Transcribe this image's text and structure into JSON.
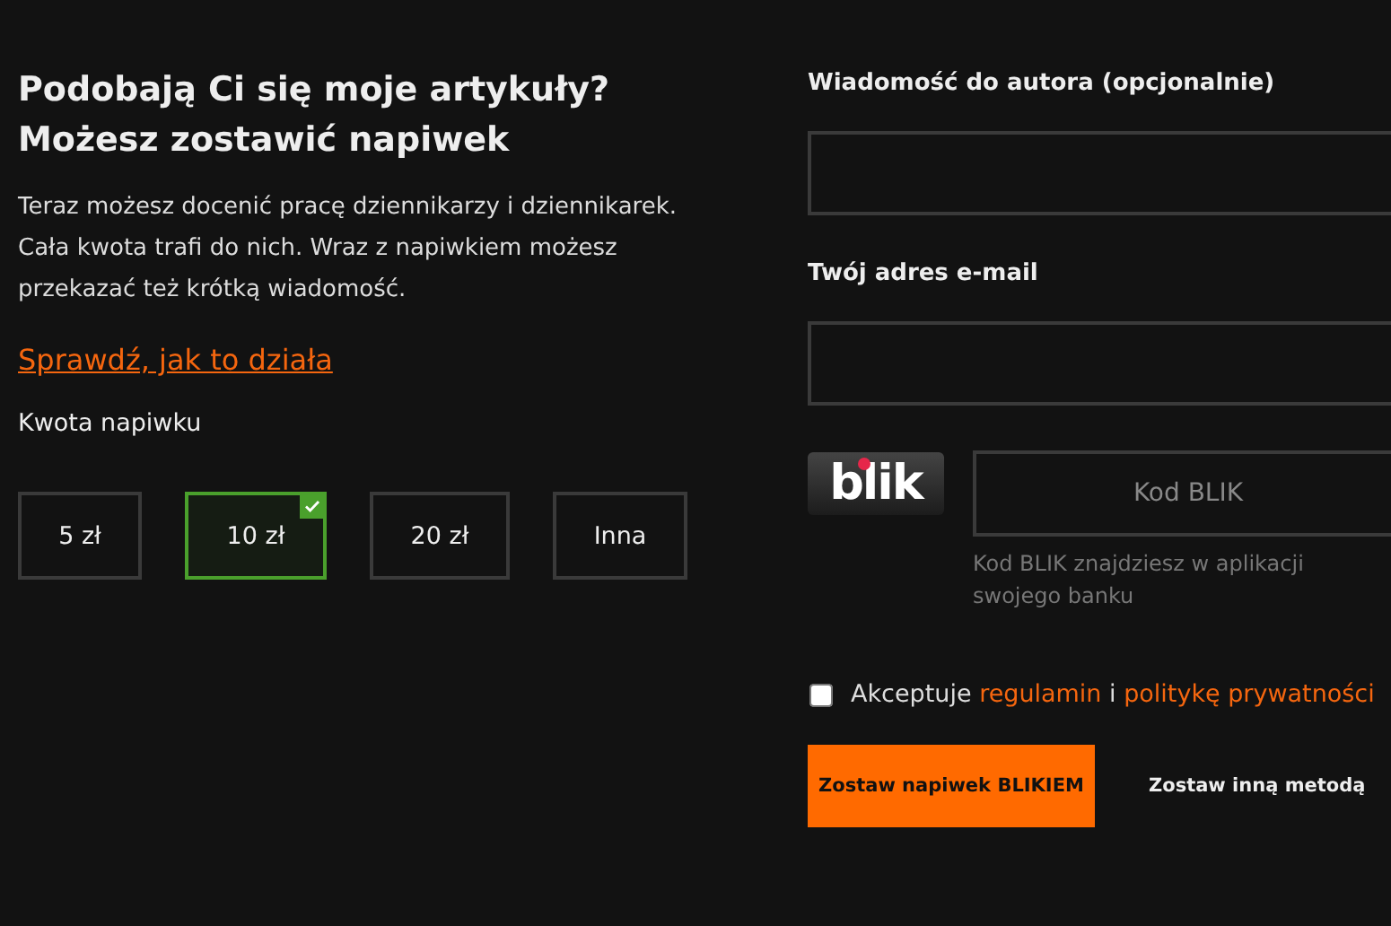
{
  "heading": [
    "Podobają Ci się moje artykuły?",
    "Możesz zostawić napiwek"
  ],
  "intro": "Teraz możesz docenić pracę dziennikarzy i dziennikarek. Cała kwota trafi do nich. Wraz z napiwkiem możesz przekazać też krótką wiadomość.",
  "how_link": "Sprawdź, jak to działa",
  "amount_label": "Kwota napiwku",
  "amounts": [
    {
      "label": "5 zł",
      "selected": false
    },
    {
      "label": "10 zł",
      "selected": true
    },
    {
      "label": "20 zł",
      "selected": false
    },
    {
      "label": "Inna",
      "selected": false
    }
  ],
  "message": {
    "label": "Wiadomość do autora (opcjonalnie)"
  },
  "email": {
    "label": "Twój adres e-mail"
  },
  "blik": {
    "logo": "blik",
    "placeholder": "Kod BLIK",
    "hint": "Kod BLIK znajdziesz w aplikacji swojego banku"
  },
  "consent": {
    "checked": false,
    "parts": [
      {
        "kind": "text",
        "text": "Akceptuje "
      },
      {
        "kind": "link",
        "text": "regulamin"
      },
      {
        "kind": "text",
        "text": " i "
      },
      {
        "kind": "link",
        "text": "politykę prywatności"
      }
    ]
  },
  "buttons": [
    {
      "kind": "primary",
      "label": "Zostaw napiwek BLIKIEM"
    },
    {
      "kind": "plain",
      "label": "Zostaw inną metodą"
    }
  ]
}
